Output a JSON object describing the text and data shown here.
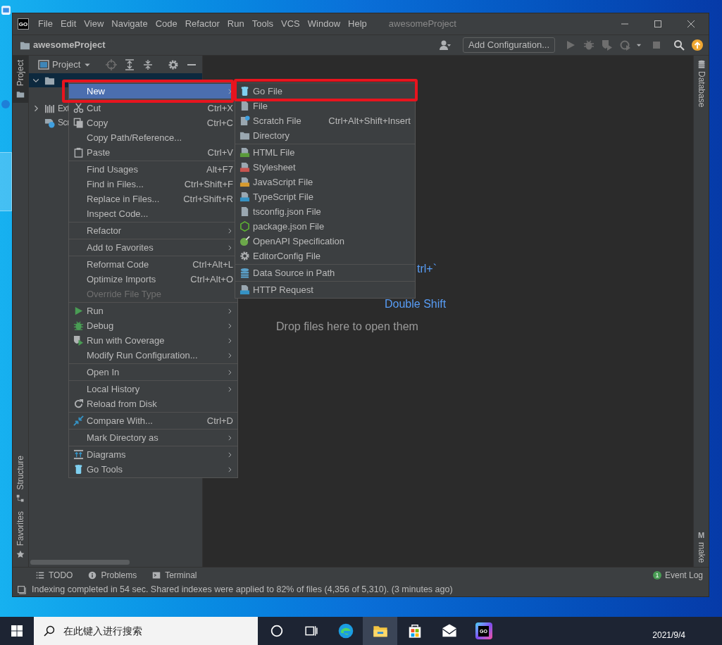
{
  "window": {
    "logo": "GO",
    "menu": [
      "File",
      "Edit",
      "View",
      "Navigate",
      "Code",
      "Refactor",
      "Run",
      "Tools",
      "VCS",
      "Window",
      "Help"
    ],
    "title": "awesomeProject"
  },
  "navbar": {
    "project": "awesomeProject",
    "run_config": "Add Configuration..."
  },
  "left_strip": {
    "top_tabs": [
      {
        "label": "Project",
        "selected": true
      }
    ],
    "bottom_tabs": [
      {
        "label": "Structure",
        "selected": false
      },
      {
        "label": "Favorites",
        "selected": false
      }
    ]
  },
  "project_panel": {
    "view": "Project",
    "tree": [
      {
        "kind": "folder",
        "expanded": true,
        "selected": true
      },
      {
        "kind": "folder",
        "label": "Ext",
        "expanded": false,
        "selected": false
      },
      {
        "kind": "leaf",
        "label": "Scr",
        "selected": false
      }
    ]
  },
  "context_menu": {
    "groups": [
      [
        {
          "label": "New",
          "selected": true,
          "disabled": false,
          "submenu": true
        }
      ],
      [
        {
          "label": "Cut",
          "shortcut": "Ctrl+X",
          "selected": false,
          "disabled": false,
          "submenu": false
        },
        {
          "label": "Copy",
          "shortcut": "Ctrl+C",
          "selected": false,
          "disabled": false,
          "submenu": false
        },
        {
          "label": "Copy Path/Reference...",
          "selected": false,
          "disabled": false,
          "submenu": false
        },
        {
          "label": "Paste",
          "shortcut": "Ctrl+V",
          "selected": false,
          "disabled": false,
          "submenu": false
        }
      ],
      [
        {
          "label": "Find Usages",
          "shortcut": "Alt+F7",
          "selected": false,
          "disabled": false,
          "submenu": false
        },
        {
          "label": "Find in Files...",
          "shortcut": "Ctrl+Shift+F",
          "selected": false,
          "disabled": false,
          "submenu": false
        },
        {
          "label": "Replace in Files...",
          "shortcut": "Ctrl+Shift+R",
          "selected": false,
          "disabled": false,
          "submenu": false
        },
        {
          "label": "Inspect Code...",
          "selected": false,
          "disabled": false,
          "submenu": false
        }
      ],
      [
        {
          "label": "Refactor",
          "selected": false,
          "disabled": false,
          "submenu": true
        }
      ],
      [
        {
          "label": "Add to Favorites",
          "selected": false,
          "disabled": false,
          "submenu": true
        }
      ],
      [
        {
          "label": "Reformat Code",
          "shortcut": "Ctrl+Alt+L",
          "selected": false,
          "disabled": false,
          "submenu": false
        },
        {
          "label": "Optimize Imports",
          "shortcut": "Ctrl+Alt+O",
          "selected": false,
          "disabled": false,
          "submenu": false
        },
        {
          "label": "Override File Type",
          "selected": false,
          "disabled": true,
          "submenu": false
        }
      ],
      [
        {
          "label": "Run",
          "selected": false,
          "disabled": false,
          "submenu": true
        },
        {
          "label": "Debug",
          "selected": false,
          "disabled": false,
          "submenu": true
        },
        {
          "label": "Run with Coverage",
          "selected": false,
          "disabled": false,
          "submenu": true
        },
        {
          "label": "Modify Run Configuration...",
          "selected": false,
          "disabled": false,
          "submenu": true
        }
      ],
      [
        {
          "label": "Open In",
          "selected": false,
          "disabled": false,
          "submenu": true
        }
      ],
      [
        {
          "label": "Local History",
          "selected": false,
          "disabled": false,
          "submenu": true
        },
        {
          "label": "Reload from Disk",
          "selected": false,
          "disabled": false,
          "submenu": false
        }
      ],
      [
        {
          "label": "Compare With...",
          "shortcut": "Ctrl+D",
          "selected": false,
          "disabled": false,
          "submenu": false
        }
      ],
      [
        {
          "label": "Mark Directory as",
          "selected": false,
          "disabled": false,
          "submenu": true
        }
      ],
      [
        {
          "label": "Diagrams",
          "selected": false,
          "disabled": false,
          "submenu": true
        },
        {
          "label": "Go Tools",
          "selected": false,
          "disabled": false,
          "submenu": true
        }
      ]
    ]
  },
  "new_submenu": {
    "groups": [
      [
        {
          "label": "Go File"
        },
        {
          "label": "File"
        },
        {
          "label": "Scratch File",
          "shortcut": "Ctrl+Alt+Shift+Insert"
        },
        {
          "label": "Directory"
        }
      ],
      [
        {
          "label": "HTML File"
        },
        {
          "label": "Stylesheet"
        },
        {
          "label": "JavaScript File"
        },
        {
          "label": "TypeScript File"
        },
        {
          "label": "tsconfig.json File"
        },
        {
          "label": "package.json File"
        },
        {
          "label": "OpenAPI Specification"
        },
        {
          "label": "EditorConfig File"
        }
      ],
      [
        {
          "label": "Data Source in Path"
        }
      ],
      [
        {
          "label": "HTTP Request"
        }
      ]
    ]
  },
  "editor_hints": [
    [
      {
        "kind": "shortcut",
        "text": "trl+`"
      }
    ],
    [
      {
        "kind": "shortcut",
        "text": "Double Shift"
      }
    ],
    [
      {
        "kind": "action",
        "text": "Drop files here to open them"
      }
    ]
  ],
  "right_strip": {
    "tabs": [
      {
        "label": "Database"
      },
      {
        "label": "make",
        "badge": "M"
      }
    ]
  },
  "bottom_bar": {
    "tabs": [
      "TODO",
      "Problems",
      "Terminal"
    ],
    "event_log": {
      "label": "Event Log",
      "count": "1"
    }
  },
  "status_bar": {
    "message": "Indexing completed in 54 sec. Shared indexes were applied to 82% of files (4,356 of 5,310). (3 minutes ago)"
  },
  "taskbar": {
    "search_placeholder": "在此键入进行搜索",
    "apps": [
      {
        "highlighted": false
      },
      {
        "highlighted": false
      },
      {
        "highlighted": false
      },
      {
        "highlighted": true
      },
      {
        "highlighted": false
      },
      {
        "highlighted": false
      },
      {
        "highlighted": false,
        "label": "GO"
      }
    ],
    "date": "2021/9/4"
  }
}
